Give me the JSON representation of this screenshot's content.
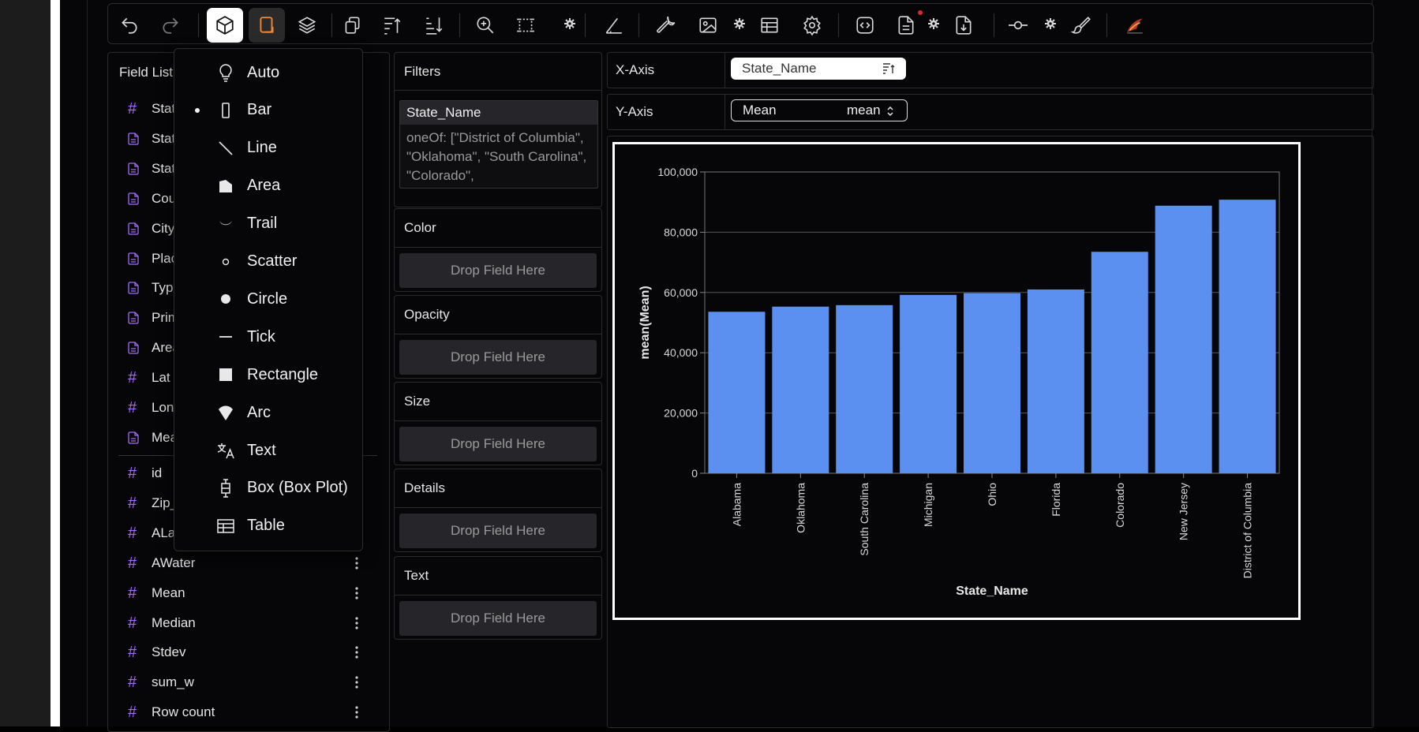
{
  "toolbar": {
    "buttons": [
      "undo-icon",
      "redo-icon",
      "cube-icon",
      "mark-type-icon",
      "layers-icon",
      "transpose-icon",
      "sort-ascending-icon",
      "sort-descending-icon",
      "zoom-icon",
      "resize-icon",
      "axes-icon",
      "wrench-icon",
      "image-icon",
      "table-icon",
      "gear-icon",
      "code-icon",
      "file-icon",
      "download-icon",
      "commit-icon",
      "brush-icon",
      "logo-icon"
    ]
  },
  "field_list": {
    "title": "Field List",
    "dimensions": [
      {
        "label": "State",
        "type": "number"
      },
      {
        "label": "State",
        "type": "text"
      },
      {
        "label": "State",
        "type": "text"
      },
      {
        "label": "Cou",
        "type": "text"
      },
      {
        "label": "City",
        "type": "text"
      },
      {
        "label": "Plac",
        "type": "text"
      },
      {
        "label": "Type",
        "type": "text"
      },
      {
        "label": "Prim",
        "type": "text"
      },
      {
        "label": "Area",
        "type": "text"
      },
      {
        "label": "Lat",
        "type": "number"
      },
      {
        "label": "Lon",
        "type": "number"
      },
      {
        "label": "Mea",
        "type": "text"
      }
    ],
    "measures": [
      {
        "label": "id"
      },
      {
        "label": "Zip_"
      },
      {
        "label": "ALan"
      },
      {
        "label": "AWater"
      },
      {
        "label": "Mean"
      },
      {
        "label": "Median"
      },
      {
        "label": "Stdev"
      },
      {
        "label": "sum_w"
      },
      {
        "label": "Row count"
      }
    ]
  },
  "mark_menu": {
    "selected": "Bar",
    "items": [
      {
        "label": "Auto",
        "icon": "lightbulb-icon"
      },
      {
        "label": "Bar",
        "icon": "bar-icon"
      },
      {
        "label": "Line",
        "icon": "line-icon"
      },
      {
        "label": "Area",
        "icon": "area-icon"
      },
      {
        "label": "Trail",
        "icon": "trail-icon"
      },
      {
        "label": "Scatter",
        "icon": "scatter-icon"
      },
      {
        "label": "Circle",
        "icon": "circle-icon"
      },
      {
        "label": "Tick",
        "icon": "tick-icon"
      },
      {
        "label": "Rectangle",
        "icon": "rectangle-icon"
      },
      {
        "label": "Arc",
        "icon": "arc-icon"
      },
      {
        "label": "Text",
        "icon": "text-icon"
      },
      {
        "label": "Box (Box Plot)",
        "icon": "boxplot-icon"
      },
      {
        "label": "Table",
        "icon": "table-icon"
      }
    ]
  },
  "encodings": {
    "filters": {
      "title": "Filters",
      "field": "State_Name",
      "rule": "oneOf: [\"District of Columbia\", \"Oklahoma\", \"South Carolina\", \"Colorado\","
    },
    "color": {
      "title": "Color",
      "drop": "Drop Field Here"
    },
    "opacity": {
      "title": "Opacity",
      "drop": "Drop Field Here"
    },
    "size": {
      "title": "Size",
      "drop": "Drop Field Here"
    },
    "details": {
      "title": "Details",
      "drop": "Drop Field Here"
    },
    "text": {
      "title": "Text",
      "drop": "Drop Field Here"
    }
  },
  "axes": {
    "x": {
      "label": "X-Axis",
      "field": "State_Name"
    },
    "y": {
      "label": "Y-Axis",
      "field": "Mean",
      "aggregate": "mean"
    }
  },
  "colors": {
    "bar": "#5b8ff0",
    "accent_orange": "#f08a3c",
    "measure_hash": "#a46cf6"
  },
  "chart_data": {
    "type": "bar",
    "categories": [
      "Alabama",
      "Oklahoma",
      "South Carolina",
      "Michigan",
      "Ohio",
      "Florida",
      "Colorado",
      "New Jersey",
      "District of Columbia"
    ],
    "values": [
      53600,
      55300,
      55800,
      59200,
      59800,
      61000,
      73500,
      88800,
      90800
    ],
    "xlabel": "State_Name",
    "ylabel": "mean(Mean)",
    "ylim": [
      0,
      100000
    ],
    "yticks": [
      "0",
      "20,000",
      "40,000",
      "60,000",
      "80,000",
      "100,000"
    ],
    "grid": true
  }
}
